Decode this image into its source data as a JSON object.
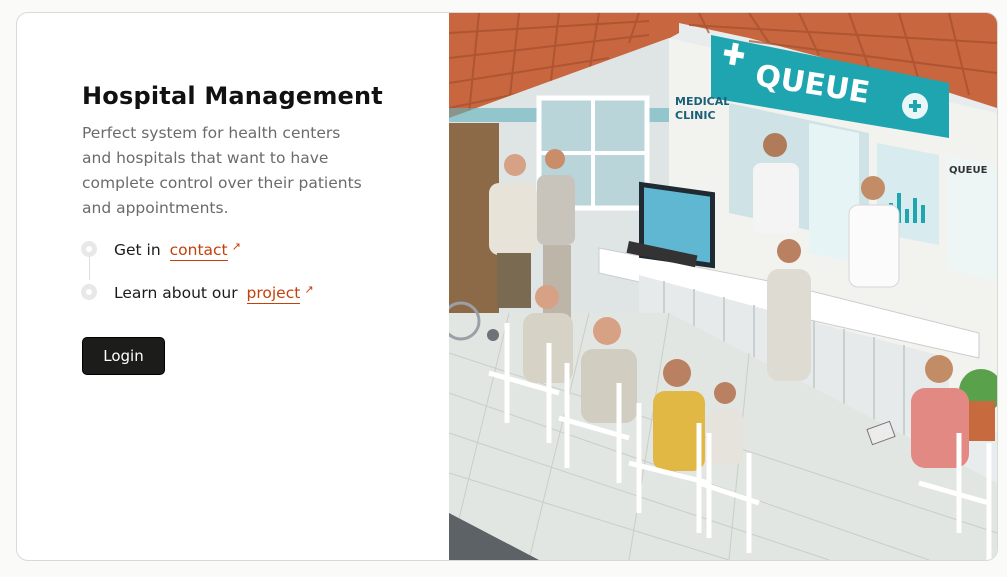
{
  "hero": {
    "title": "Hospital Management",
    "subtitle": "Perfect system for health centers and hospitals that want to have complete control over their patients and appointments."
  },
  "steps": [
    {
      "prefix": "Get in",
      "link": "contact",
      "icon": "external-arrow-icon"
    },
    {
      "prefix": "Learn about our",
      "link": "project",
      "icon": "external-arrow-icon"
    }
  ],
  "login_label": "Login",
  "illustration": {
    "sign_main": "QUEUE",
    "sign_side_top": "MEDICAL",
    "sign_side_bottom": "CLINIC",
    "sign_right": "QUEUE"
  },
  "colors": {
    "accent": "#c2410c",
    "button": "#1c1c1a",
    "teal": "#1ea5b0"
  }
}
